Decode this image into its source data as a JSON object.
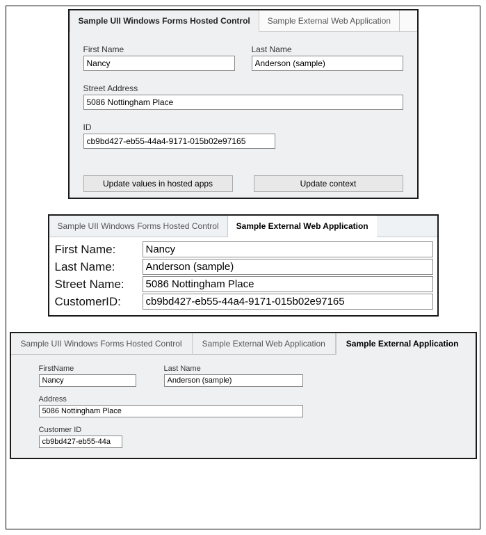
{
  "panel1": {
    "tabs": [
      {
        "label": "Sample UII Windows Forms Hosted Control",
        "active": true
      },
      {
        "label": "Sample External Web Application",
        "active": false
      }
    ],
    "firstNameLabel": "First Name",
    "firstNameValue": "Nancy",
    "lastNameLabel": "Last Name",
    "lastNameValue": "Anderson (sample)",
    "streetLabel": "Street Address",
    "streetValue": "5086 Nottingham Place",
    "idLabel": "ID",
    "idValue": "cb9bd427-eb55-44a4-9171-015b02e97165",
    "btnUpdateApps": "Update values in hosted apps",
    "btnUpdateContext": "Update context"
  },
  "panel2": {
    "tabs": [
      {
        "label": "Sample UII Windows Forms Hosted Control",
        "active": false
      },
      {
        "label": "Sample External Web Application",
        "active": true
      }
    ],
    "firstNameLabel": "First Name:",
    "firstNameValue": "Nancy",
    "lastNameLabel": "Last Name:",
    "lastNameValue": "Anderson (sample)",
    "streetLabel": "Street Name:",
    "streetValue": "5086 Nottingham Place",
    "idLabel": "CustomerID:",
    "idValue": "cb9bd427-eb55-44a4-9171-015b02e97165"
  },
  "panel3": {
    "tabs": [
      {
        "label": "Sample UII Windows Forms Hosted Control",
        "active": false
      },
      {
        "label": "Sample External Web Application",
        "active": false
      },
      {
        "label": "Sample External Application",
        "active": true
      }
    ],
    "firstNameLabel": "FirstName",
    "firstNameValue": "Nancy",
    "lastNameLabel": "Last Name",
    "lastNameValue": "Anderson (sample)",
    "addressLabel": "Address",
    "addressValue": "5086 Nottingham Place",
    "idLabel": "Customer ID",
    "idValue": "cb9bd427-eb55-44a"
  }
}
